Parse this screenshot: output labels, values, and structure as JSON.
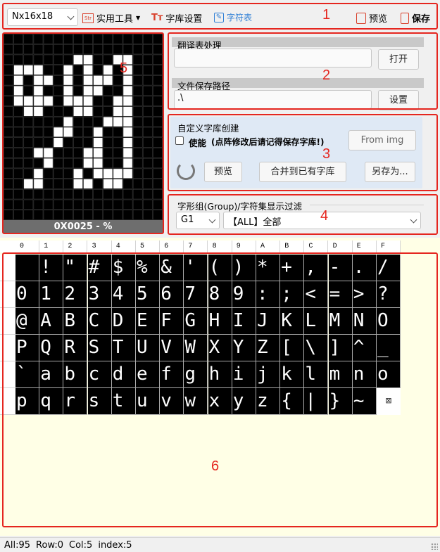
{
  "toolbar": {
    "size_select": "Nx16x18",
    "tools_label": "实用工具",
    "font_settings_label": "字库设置",
    "char_table_label": "字符表",
    "preview_label": "预览",
    "save_label": "保存"
  },
  "preview": {
    "caption": "0X0025 - %",
    "grid_cols": 16,
    "grid_rows": 18,
    "pixels": [
      [
        2,
        7
      ],
      [
        2,
        8
      ],
      [
        2,
        11
      ],
      [
        2,
        12
      ],
      [
        3,
        1
      ],
      [
        3,
        2
      ],
      [
        3,
        3
      ],
      [
        3,
        6
      ],
      [
        3,
        8
      ],
      [
        3,
        10
      ],
      [
        3,
        12
      ],
      [
        4,
        1
      ],
      [
        4,
        3
      ],
      [
        4,
        4
      ],
      [
        4,
        6
      ],
      [
        4,
        8
      ],
      [
        4,
        9
      ],
      [
        4,
        10
      ],
      [
        4,
        12
      ],
      [
        5,
        1
      ],
      [
        5,
        3
      ],
      [
        5,
        6
      ],
      [
        5,
        8
      ],
      [
        5,
        9
      ],
      [
        5,
        12
      ],
      [
        6,
        1
      ],
      [
        6,
        2
      ],
      [
        6,
        3
      ],
      [
        6,
        4
      ],
      [
        6,
        6
      ],
      [
        6,
        7
      ],
      [
        6,
        8
      ],
      [
        6,
        11
      ],
      [
        6,
        12
      ],
      [
        7,
        2
      ],
      [
        7,
        3
      ],
      [
        7,
        7
      ],
      [
        7,
        8
      ],
      [
        7,
        11
      ],
      [
        7,
        12
      ],
      [
        8,
        6
      ],
      [
        8,
        10
      ],
      [
        8,
        11
      ],
      [
        8,
        12
      ],
      [
        9,
        5
      ],
      [
        9,
        6
      ],
      [
        9,
        9
      ],
      [
        9,
        12
      ],
      [
        10,
        5
      ],
      [
        10,
        9
      ],
      [
        10,
        12
      ],
      [
        11,
        3
      ],
      [
        11,
        4
      ],
      [
        11,
        8
      ],
      [
        11,
        9
      ],
      [
        11,
        12
      ],
      [
        12,
        4
      ],
      [
        12,
        8
      ],
      [
        12,
        9
      ],
      [
        12,
        12
      ],
      [
        13,
        3
      ],
      [
        13,
        7
      ],
      [
        13,
        9
      ],
      [
        13,
        10
      ],
      [
        13,
        11
      ],
      [
        13,
        12
      ],
      [
        14,
        2
      ],
      [
        14,
        3
      ],
      [
        14,
        7
      ],
      [
        14,
        8
      ],
      [
        14,
        10
      ],
      [
        14,
        11
      ]
    ]
  },
  "translate": {
    "title": "翻译表处理",
    "value": "",
    "open_label": "打开"
  },
  "savepath": {
    "title": "文件保存路径",
    "value": ".\\",
    "set_label": "设置"
  },
  "custom": {
    "title": "自定义字库创建",
    "enable_label": "使能",
    "note": "(点阵修改后请记得保存字库!)",
    "from_img_label": "From img",
    "preview_label": "预览",
    "merge_label": "合并到已有字库",
    "save_as_label": "另存为..."
  },
  "filter": {
    "title": "字形组(Group)/字符集显示过滤",
    "group_value": "G1",
    "charset_value": "【ALL】全部"
  },
  "char_table": {
    "col_headers": [
      "0",
      "1",
      "2",
      "3",
      "4",
      "5",
      "6",
      "7",
      "8",
      "9",
      "A",
      "B",
      "C",
      "D",
      "E",
      "F"
    ],
    "rows": [
      [
        " ",
        "!",
        "\"",
        "#",
        "$",
        "%",
        "&",
        "'",
        "(",
        ")",
        "*",
        "+",
        ",",
        "-",
        ".",
        "/"
      ],
      [
        "0",
        "1",
        "2",
        "3",
        "4",
        "5",
        "6",
        "7",
        "8",
        "9",
        ":",
        ";",
        "<",
        "=",
        ">",
        "?"
      ],
      [
        "@",
        "A",
        "B",
        "C",
        "D",
        "E",
        "F",
        "G",
        "H",
        "I",
        "J",
        "K",
        "L",
        "M",
        "N",
        "O"
      ],
      [
        "P",
        "Q",
        "R",
        "S",
        "T",
        "U",
        "V",
        "W",
        "X",
        "Y",
        "Z",
        "[",
        "\\",
        "]",
        "^",
        "_"
      ],
      [
        "`",
        "a",
        "b",
        "c",
        "d",
        "e",
        "f",
        "g",
        "h",
        "i",
        "j",
        "k",
        "l",
        "m",
        "n",
        "o"
      ],
      [
        "p",
        "q",
        "r",
        "s",
        "t",
        "u",
        "v",
        "w",
        "x",
        "y",
        "z",
        "{",
        "|",
        "}",
        "~",
        "⊠"
      ]
    ]
  },
  "annotations": [
    "1",
    "2",
    "3",
    "4",
    "5",
    "6"
  ],
  "status": {
    "all": "All:95",
    "row": "Row:0",
    "col": "Col:5",
    "index": "index:5"
  },
  "colors": {
    "accent_red": "#e5261f",
    "table_bg": "#ffffe6",
    "preview_bg": "#000000",
    "pixel_on": "#ffffff"
  }
}
